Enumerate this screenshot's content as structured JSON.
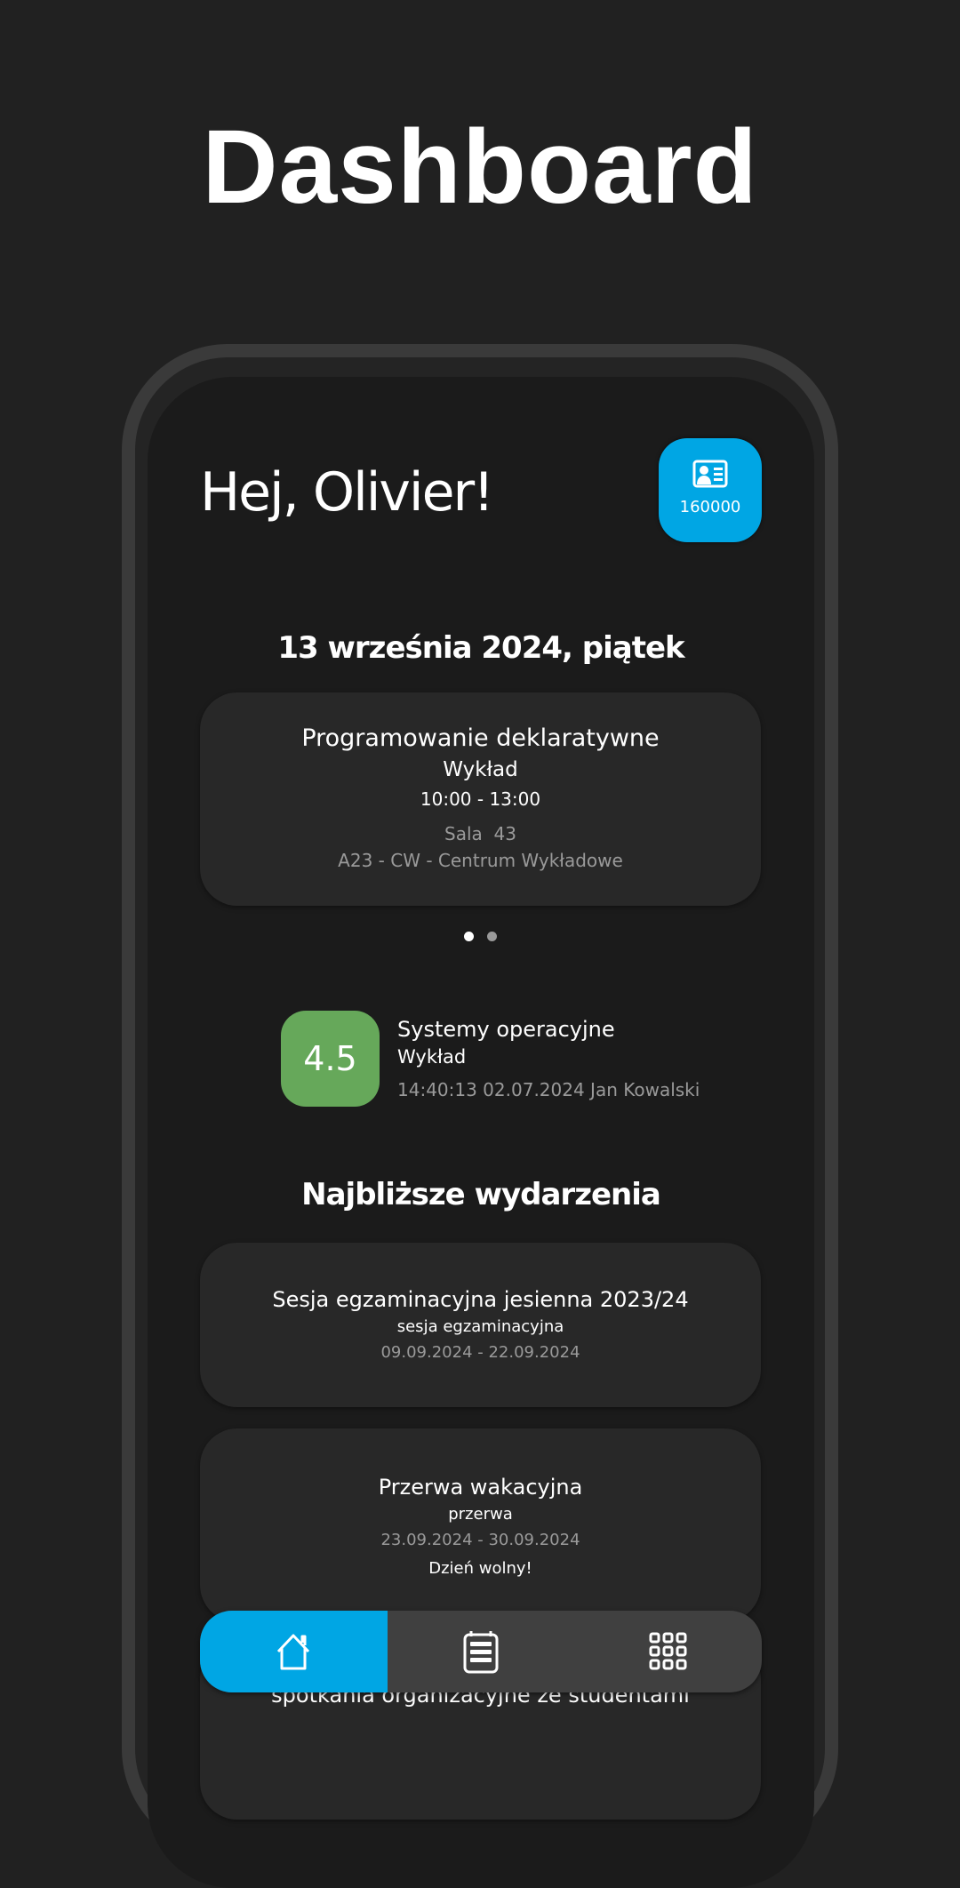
{
  "page_title": "Dashboard",
  "greeting": "Hej, Olivier!",
  "student_id": {
    "icon": "id-card-icon",
    "number": "160000"
  },
  "today": {
    "date_heading": "13 września 2024, piątek",
    "classes": [
      {
        "name": "Programowanie deklaratywne",
        "type": "Wykład",
        "time": "10:00 - 13:00",
        "room": "Sala  43",
        "building": "A23 - CW - Centrum Wykładowe"
      }
    ],
    "carousel": {
      "pages": 2,
      "active": 1
    }
  },
  "latest_grade": {
    "value": "4.5",
    "subject": "Systemy operacyjne",
    "type": "Wykład",
    "meta": "14:40:13 02.07.2024 Jan Kowalski",
    "color": "#66a85a"
  },
  "events": {
    "heading": "Najbliższe wydarzenia",
    "items": [
      {
        "title": "Sesja egzaminacyjna jesienna 2023/24",
        "type": "sesja egzaminacyjna",
        "dates": "09.09.2024 - 22.09.2024"
      },
      {
        "title": "Przerwa wakacyjna",
        "type": "przerwa",
        "dates": "23.09.2024 - 30.09.2024",
        "note": "Dzień wolny!"
      },
      {
        "title": "spotkania organizacyjne ze studentami"
      }
    ]
  },
  "nav": [
    {
      "icon": "home-icon",
      "active": true
    },
    {
      "icon": "schedule-icon",
      "active": false
    },
    {
      "icon": "grid-menu-icon",
      "active": false
    }
  ],
  "colors": {
    "accent": "#00a6e4",
    "background": "#1b1b1b",
    "card": "#282828"
  }
}
